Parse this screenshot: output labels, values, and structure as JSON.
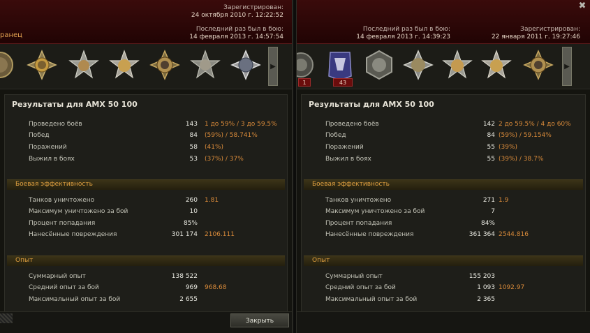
{
  "left": {
    "header": {
      "registered_label": "Зарегистрирован:",
      "registered_date": "24 октября 2010 г. 12:22:52",
      "last_battle_label": "Последний раз был в бою:",
      "last_battle_date": "14 февраля 2013 г. 14:57:54",
      "nick_fragment": "ранец"
    },
    "title": "Результаты для AMX 50 100",
    "sections": {
      "battle": "Боевая эффективность",
      "xp": "Опыт"
    },
    "stats": {
      "battles": {
        "label": "Проведено боёв",
        "value": "143",
        "extra": "1 до 59% / 3 до 59.5%"
      },
      "wins": {
        "label": "Побед",
        "value": "84",
        "extra": "(59%)  /  58.741%"
      },
      "losses": {
        "label": "Поражений",
        "value": "58",
        "extra": "(41%)"
      },
      "survived": {
        "label": "Выжил в боях",
        "value": "53",
        "extra": "(37%)  /  37%"
      },
      "kills": {
        "label": "Танков уничтожено",
        "value": "260",
        "extra": "1.81"
      },
      "max_kills": {
        "label": "Максимум уничтожено за бой",
        "value": "10"
      },
      "hit_rate": {
        "label": "Процент попадания",
        "value": "85%"
      },
      "damage": {
        "label": "Нанесённые повреждения",
        "value": "301 174",
        "extra": "2106.111"
      },
      "total_xp": {
        "label": "Суммарный опыт",
        "value": "138 522"
      },
      "avg_xp": {
        "label": "Средний опыт за бой",
        "value": "969",
        "extra": "968.68"
      },
      "max_xp": {
        "label": "Максимальный опыт за бой",
        "value": "2 655"
      }
    },
    "close_button": "Закрыть"
  },
  "right": {
    "header": {
      "registered_label": "Зарегистрирован:",
      "registered_date": "22 января 2011 г. 19:27:46",
      "last_battle_label": "Последний раз был в бою:",
      "last_battle_date": "14 февраля 2013 г. 14:39:23"
    },
    "badges": [
      "1",
      "43"
    ],
    "title": "Результаты для AMX 50 100",
    "sections": {
      "battle": "Боевая эффективность",
      "xp": "Опыт"
    },
    "stats": {
      "battles": {
        "label": "Проведено боёв",
        "value": "142",
        "extra": "2 до 59.5% / 4 до 60%"
      },
      "wins": {
        "label": "Побед",
        "value": "84",
        "extra": "(59%)  /  59.154%"
      },
      "losses": {
        "label": "Поражений",
        "value": "55",
        "extra": "(39%)"
      },
      "survived": {
        "label": "Выжил в боях",
        "value": "55",
        "extra": "(39%)  /  38.7%"
      },
      "kills": {
        "label": "Танков уничтожено",
        "value": "271",
        "extra": "1.9"
      },
      "max_kills": {
        "label": "Максимум уничтожено за бой",
        "value": "7"
      },
      "hit_rate": {
        "label": "Процент попадания",
        "value": "84%"
      },
      "damage": {
        "label": "Нанесённые повреждения",
        "value": "361 364",
        "extra": "2544.816"
      },
      "total_xp": {
        "label": "Суммарный опыт",
        "value": "155 203"
      },
      "avg_xp": {
        "label": "Средний опыт за бой",
        "value": "1 093",
        "extra": "1092.97"
      },
      "max_xp": {
        "label": "Максимальный опыт за бой",
        "value": "2 365"
      }
    },
    "close_icon": "close-icon"
  }
}
